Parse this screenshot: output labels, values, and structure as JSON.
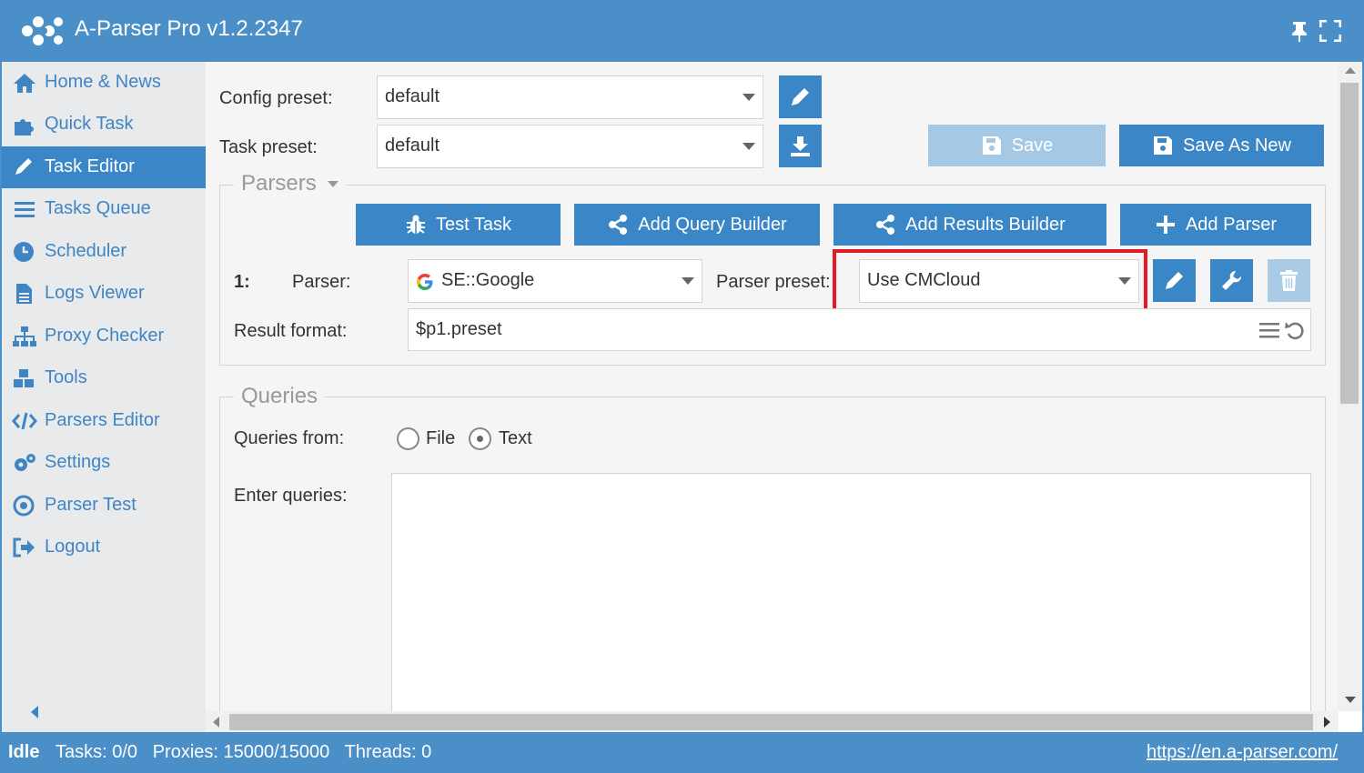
{
  "app": {
    "title": "A-Parser Pro v1.2.2347"
  },
  "sidebar": {
    "items": [
      {
        "label": "Home & News",
        "icon": "home-icon"
      },
      {
        "label": "Quick Task",
        "icon": "puzzle-icon"
      },
      {
        "label": "Task Editor",
        "icon": "pencil-icon",
        "active": true
      },
      {
        "label": "Tasks Queue",
        "icon": "list-icon"
      },
      {
        "label": "Scheduler",
        "icon": "clock-icon"
      },
      {
        "label": "Logs Viewer",
        "icon": "file-icon"
      },
      {
        "label": "Proxy Checker",
        "icon": "sitemap-icon"
      },
      {
        "label": "Tools",
        "icon": "cubes-icon"
      },
      {
        "label": "Parsers Editor",
        "icon": "code-icon"
      },
      {
        "label": "Settings",
        "icon": "gears-icon"
      },
      {
        "label": "Parser Test",
        "icon": "target-icon"
      },
      {
        "label": "Logout",
        "icon": "logout-icon"
      }
    ]
  },
  "config": {
    "label": "Config preset:",
    "value": "default"
  },
  "task": {
    "label": "Task preset:",
    "value": "default"
  },
  "toolbar": {
    "save_label": "Save",
    "save_as_new_label": "Save As New"
  },
  "parsers": {
    "legend": "Parsers",
    "buttons": {
      "test_task": "Test Task",
      "add_query_builder": "Add Query Builder",
      "add_results_builder": "Add Results Builder",
      "add_parser": "Add Parser"
    },
    "row_number": "1:",
    "parser_label": "Parser:",
    "parser_value": "SE::Google",
    "preset_label": "Parser preset:",
    "preset_value": "Use CMCloud",
    "result_format_label": "Result format:",
    "result_format_value": "$p1.preset"
  },
  "queries": {
    "legend": "Queries",
    "from_label": "Queries from:",
    "option_file": "File",
    "option_text": "Text",
    "selected": "Text",
    "enter_label": "Enter queries:",
    "value": ""
  },
  "status": {
    "state": "Idle",
    "stats": "Tasks: 0/0   Proxies: 15000/15000   Threads: 0",
    "link": "https://en.a-parser.com/"
  },
  "colors": {
    "primary": "#3b86c6",
    "titlebar": "#4a8fc7",
    "highlight": "#e21b23",
    "disabled": "#a5c8e5"
  }
}
